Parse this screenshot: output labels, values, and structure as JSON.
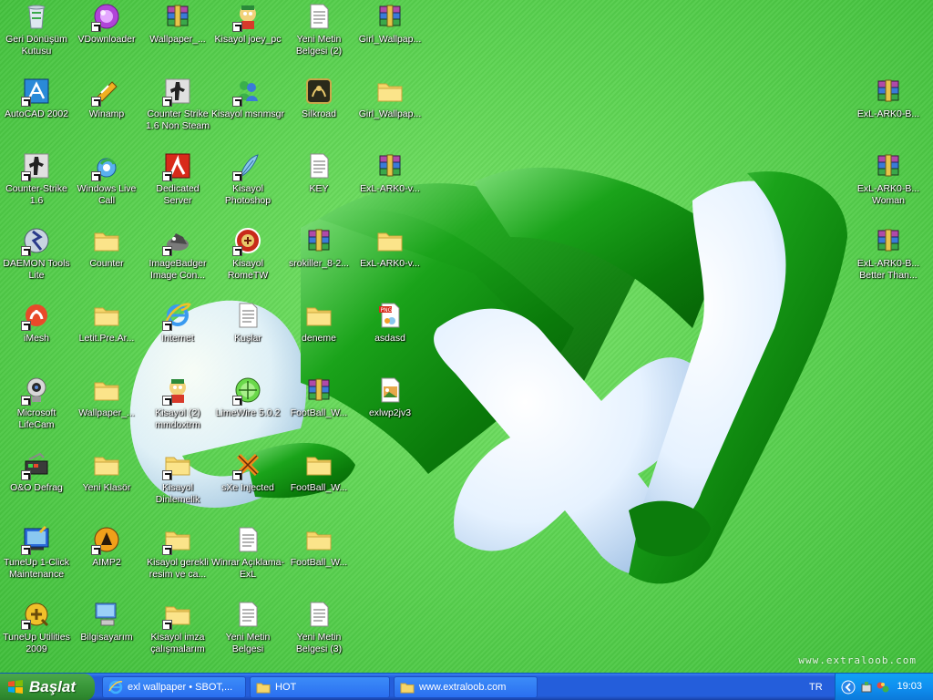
{
  "desktop": {
    "watermark": "www.extraloob.com",
    "icons": [
      {
        "label": "Geri Dönüşüm Kutusu",
        "glyph": "recycle-bin-icon",
        "shortcut": false
      },
      {
        "label": "VDownloader",
        "glyph": "vdownloader-icon",
        "shortcut": true
      },
      {
        "label": "Wallpaper_...",
        "glyph": "winrar-archive-icon",
        "shortcut": false
      },
      {
        "label": "Kisayol joey_pc",
        "glyph": "cartoon-character-icon",
        "shortcut": true
      },
      {
        "label": "Yeni Metin Belgesi (2)",
        "glyph": "text-document-icon",
        "shortcut": false
      },
      {
        "label": "Girl_Wallpap...",
        "glyph": "winrar-archive-icon",
        "shortcut": false
      },
      {
        "label": "AutoCAD 2002",
        "glyph": "autocad-icon",
        "shortcut": true
      },
      {
        "label": "Winamp",
        "glyph": "winamp-icon",
        "shortcut": true
      },
      {
        "label": "Counter Strike 1.6 Non Steam",
        "glyph": "counter-strike-icon",
        "shortcut": true
      },
      {
        "label": "Kisayol msnmsgr",
        "glyph": "msn-messenger-icon",
        "shortcut": true
      },
      {
        "label": "Silkroad",
        "glyph": "silkroad-icon",
        "shortcut": false
      },
      {
        "label": "Girl_Wallpap...",
        "glyph": "folder-icon",
        "shortcut": false
      },
      {
        "label": "Counter-Strike 1.6",
        "glyph": "counter-strike-icon",
        "shortcut": true
      },
      {
        "label": "Windows Live Call",
        "glyph": "windows-live-call-icon",
        "shortcut": true
      },
      {
        "label": "Dedicated Server",
        "glyph": "half-life-icon",
        "shortcut": true
      },
      {
        "label": "Kisayol Photoshop",
        "glyph": "photoshop-feather-icon",
        "shortcut": true
      },
      {
        "label": "KEY",
        "glyph": "text-document-icon",
        "shortcut": false
      },
      {
        "label": "ExL-ARK0-v...",
        "glyph": "winrar-archive-icon",
        "shortcut": false
      },
      {
        "label": "DAEMON Tools Lite",
        "glyph": "daemon-tools-icon",
        "shortcut": true
      },
      {
        "label": "Counter",
        "glyph": "folder-icon",
        "shortcut": false
      },
      {
        "label": "ImageBadger Image Con...",
        "glyph": "imagebadger-icon",
        "shortcut": true
      },
      {
        "label": "Kisayol RomeTW",
        "glyph": "rome-tw-icon",
        "shortcut": true
      },
      {
        "label": "srokiller_8-2...",
        "glyph": "winrar-archive-icon",
        "shortcut": false
      },
      {
        "label": "ExL-ARK0-v...",
        "glyph": "folder-icon",
        "shortcut": false
      },
      {
        "label": "iMesh",
        "glyph": "imesh-icon",
        "shortcut": true
      },
      {
        "label": "Letit.Pre.Ar...",
        "glyph": "folder-icon",
        "shortcut": false
      },
      {
        "label": "Internet",
        "glyph": "internet-explorer-icon",
        "shortcut": true
      },
      {
        "label": "Kuşlar",
        "glyph": "text-document-icon",
        "shortcut": false
      },
      {
        "label": "deneme",
        "glyph": "folder-icon",
        "shortcut": false
      },
      {
        "label": "asdasd",
        "glyph": "png-image-icon",
        "shortcut": false
      },
      {
        "label": "Microsoft LifeCam",
        "glyph": "webcam-icon",
        "shortcut": true
      },
      {
        "label": "Wallpaper_...",
        "glyph": "folder-icon",
        "shortcut": false
      },
      {
        "label": "Kisayol (2) mmdoxtrm",
        "glyph": "cartoon-character-icon",
        "shortcut": true
      },
      {
        "label": "LimeWire 5.0.2",
        "glyph": "limewire-icon",
        "shortcut": true
      },
      {
        "label": "FootBall_W...",
        "glyph": "winrar-archive-icon",
        "shortcut": false
      },
      {
        "label": "exlwp2jv3",
        "glyph": "image-file-icon",
        "shortcut": false
      },
      {
        "label": "O&O Defrag",
        "glyph": "defrag-icon",
        "shortcut": true
      },
      {
        "label": "Yeni Klasör",
        "glyph": "folder-icon",
        "shortcut": false
      },
      {
        "label": "Kisayol Dinlemelik",
        "glyph": "folder-icon",
        "shortcut": true
      },
      {
        "label": "sXe Injected",
        "glyph": "sxe-injected-icon",
        "shortcut": true
      },
      {
        "label": "FootBall_W...",
        "glyph": "folder-icon",
        "shortcut": false
      },
      {
        "label": "TuneUp 1-Click Maintenance",
        "glyph": "tuneup-icon",
        "shortcut": true
      },
      {
        "label": "AIMP2",
        "glyph": "aimp-icon",
        "shortcut": true
      },
      {
        "label": "Kisayol gerekli resim ve ca...",
        "glyph": "folder-icon",
        "shortcut": true
      },
      {
        "label": "Winrar Açıklama-ExL",
        "glyph": "text-document-icon",
        "shortcut": false
      },
      {
        "label": "FootBall_W...",
        "glyph": "folder-icon",
        "shortcut": false
      },
      {
        "label": "TuneUp Utilities 2009",
        "glyph": "tuneup-utilities-icon",
        "shortcut": true
      },
      {
        "label": "Bilgisayarım",
        "glyph": "my-computer-icon",
        "shortcut": false
      },
      {
        "label": "Kisayol imza çalışmalarım",
        "glyph": "folder-icon",
        "shortcut": true
      },
      {
        "label": "Yeni Metin Belgesi",
        "glyph": "text-document-icon",
        "shortcut": false
      },
      {
        "label": "Yeni Metin Belgesi (3)",
        "glyph": "text-document-icon",
        "shortcut": false
      },
      {
        "label": "ExL-ARK0-B...",
        "glyph": "winrar-archive-icon",
        "shortcut": false
      },
      {
        "label": "ExL-ARK0-B... Woman",
        "glyph": "winrar-archive-icon",
        "shortcut": false
      },
      {
        "label": "ExL-ARK0-B... Better Than...",
        "glyph": "winrar-archive-icon",
        "shortcut": false
      }
    ]
  },
  "taskbar": {
    "start_label": "Başlat",
    "tasks": [
      {
        "label": "exl wallpaper • SBOT,...",
        "icon": "internet-explorer-icon"
      },
      {
        "label": "HOT",
        "icon": "folder-icon"
      },
      {
        "label": "www.extraloob.com",
        "icon": "folder-icon"
      }
    ],
    "language": "TR",
    "clock": "19:03"
  }
}
